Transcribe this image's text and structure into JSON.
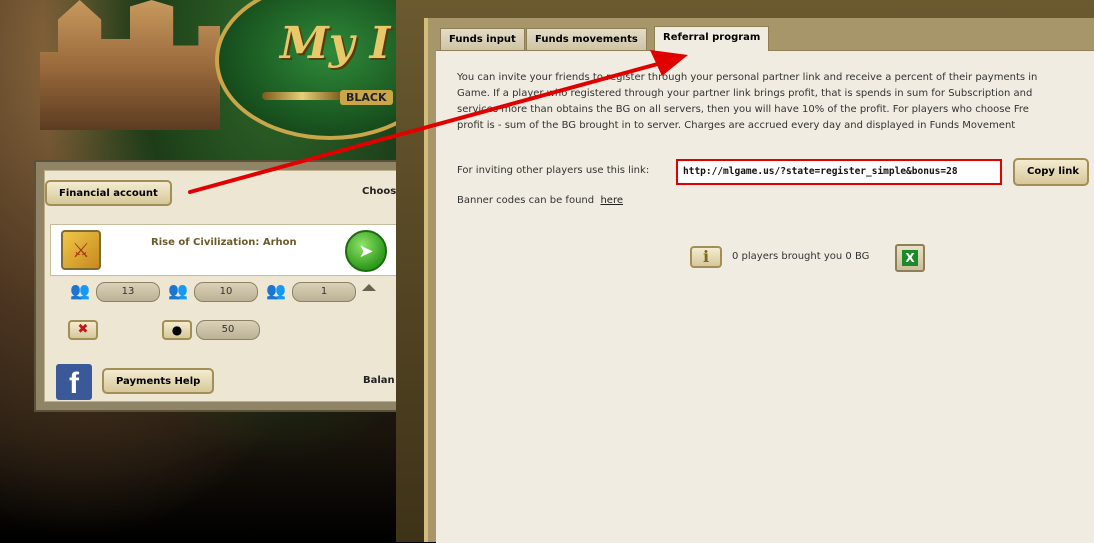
{
  "left": {
    "logo_text": "My I",
    "logo_badge": "BLACK",
    "financial_account_btn": "Financial account",
    "choose_label": "Choos",
    "game": {
      "title": "Rise of Civilization: Arhon",
      "stats": [
        "13",
        "10",
        "1"
      ],
      "coin_value": "50"
    },
    "payments_help_btn": "Payments Help",
    "balance_label": "Balan",
    "facebook_letter": "f"
  },
  "tabs": [
    {
      "label": "Funds input",
      "active": false
    },
    {
      "label": "Funds movements",
      "active": false
    },
    {
      "label": "Referral program",
      "active": true
    }
  ],
  "referral": {
    "paragraph_lines": [
      "You can invite your friends to register through your personal partner link and receive a percent of their payments in",
      "Game. If a player who registered through your partner link brings profit, that is spends in sum for Subscription and",
      "services more than obtains the BG on all servers, then you will have 10% of the profit. For players who choose Fre",
      "profit is - sum of the BG brought in to server.  Charges are accrued every day and displayed in Funds Movement"
    ],
    "invite_label": "For inviting other players use this link:",
    "link": "http://mlgame.us/?state=register_simple&bonus=28",
    "copy_button": "Copy link",
    "banner_text": "Banner codes can be found",
    "banner_link": "here",
    "players_text": "0 players brought you 0 BG"
  },
  "colors": {
    "highlight": "#e00000",
    "arrow": "#e00000"
  }
}
